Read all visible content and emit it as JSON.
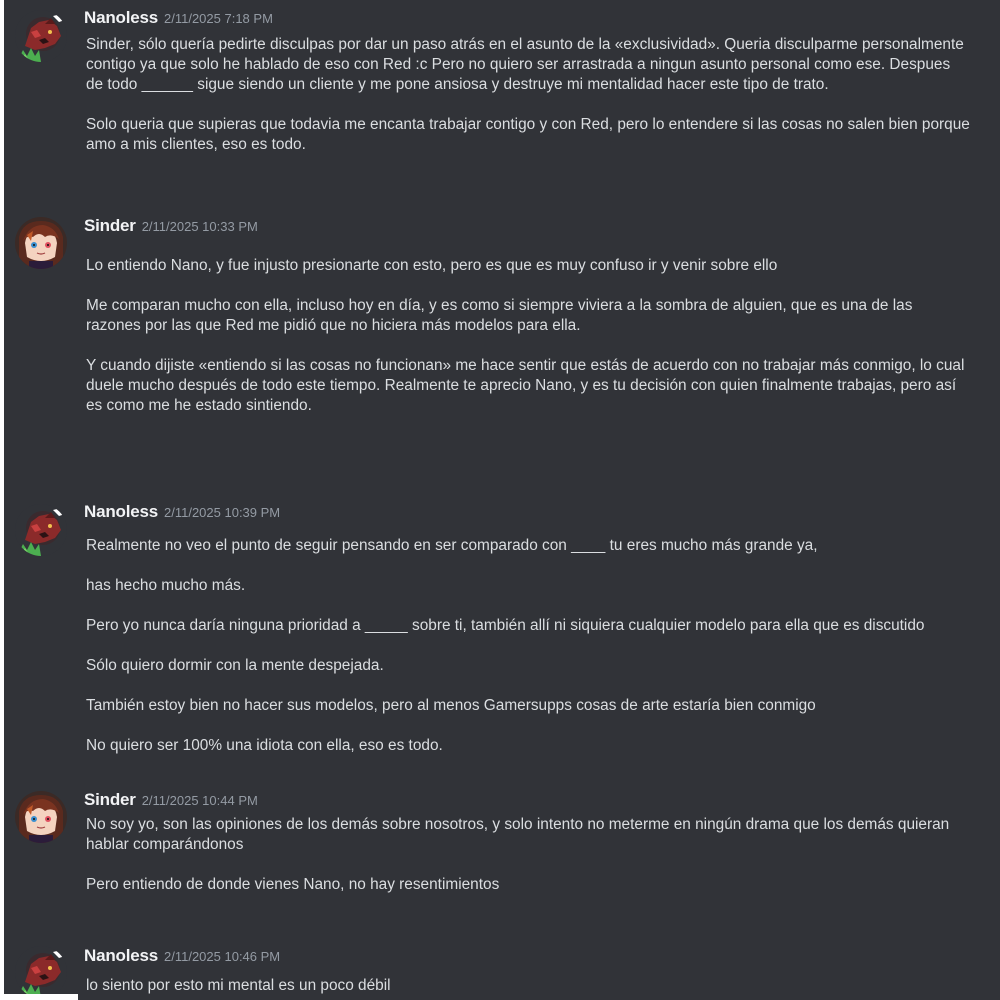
{
  "messages": [
    {
      "username": "Nanoless",
      "timestamp": "2/11/2025 7:18 PM",
      "avatar_icon": "dragon-avatar-icon",
      "paragraphs": [
        "Sinder, sólo quería pedirte disculpas por dar un paso atrás en el asunto de la «exclusividad». Queria disculparme personalmente contigo ya que solo he hablado de eso con Red :c Pero no quiero ser arrastrada a ningun asunto personal como ese. Despues de todo ______ sigue siendo un cliente y me pone ansiosa y destruye mi mentalidad hacer este tipo de trato.",
        "Solo queria que supieras que todavia me encanta trabajar contigo y con Red, pero lo entendere si las cosas no salen bien porque amo a mis clientes, eso es todo."
      ]
    },
    {
      "username": "Sinder",
      "timestamp": "2/11/2025 10:33 PM",
      "avatar_icon": "anime-girl-avatar-icon",
      "paragraphs": [
        "Lo entiendo Nano, y fue injusto presionarte con esto, pero es que es muy confuso ir y venir sobre ello",
        "Me comparan mucho con ella, incluso hoy en día, y es como si siempre viviera a la sombra de alguien, que es una de las razones por las que Red me pidió que no hiciera más modelos para ella.",
        "Y cuando dijiste «entiendo si las cosas no funcionan» me hace sentir que estás de acuerdo con no trabajar más conmigo, lo cual duele mucho después de todo este tiempo. Realmente te aprecio Nano, y es tu decisión con quien finalmente trabajas, pero así es como me he estado sintiendo."
      ]
    },
    {
      "username": "Nanoless",
      "timestamp": "2/11/2025 10:39 PM",
      "avatar_icon": "dragon-avatar-icon",
      "paragraphs": [
        "Realmente no veo el punto de seguir pensando en ser comparado con ____ tu eres mucho más grande ya,",
        "has hecho mucho más.",
        "Pero yo nunca daría ninguna prioridad a _____ sobre ti, también allí ni siquiera cualquier modelo para ella que es discutido",
        "Sólo quiero dormir con la mente despejada.",
        "También estoy bien no hacer sus modelos, pero al menos Gamersupps cosas de arte estaría bien conmigo",
        "No quiero ser 100% una idiota con ella, eso es todo."
      ]
    },
    {
      "username": "Sinder",
      "timestamp": "2/11/2025 10:44 PM",
      "avatar_icon": "anime-girl-avatar-icon",
      "paragraphs": [
        "No soy yo, son las opiniones de los demás sobre nosotros, y solo intento no meterme en ningún drama que los demás quieran hablar comparándonos",
        "Pero entiendo de donde vienes Nano, no hay resentimientos"
      ]
    },
    {
      "username": "Nanoless",
      "timestamp": "2/11/2025 10:46 PM",
      "avatar_icon": "dragon-avatar-icon",
      "paragraphs": [
        "lo siento por esto mi mental es un poco débil"
      ]
    }
  ]
}
